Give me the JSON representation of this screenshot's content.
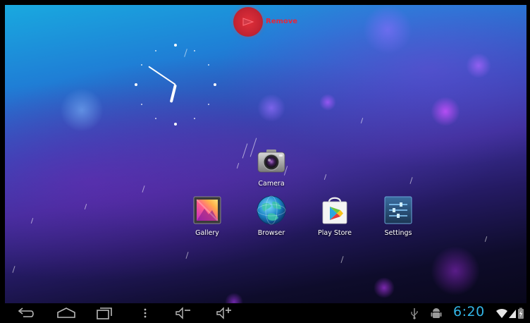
{
  "remove_zone": {
    "label": "Remove"
  },
  "apps": [
    {
      "id": "camera",
      "label": "Camera"
    },
    {
      "id": "gallery",
      "label": "Gallery"
    },
    {
      "id": "browser",
      "label": "Browser"
    },
    {
      "id": "play_store",
      "label": "Play Store"
    },
    {
      "id": "settings",
      "label": "Settings"
    }
  ],
  "status_bar": {
    "time": "6:20"
  },
  "colors": {
    "accent": "#33b5e5",
    "remove": "#e8263a"
  }
}
